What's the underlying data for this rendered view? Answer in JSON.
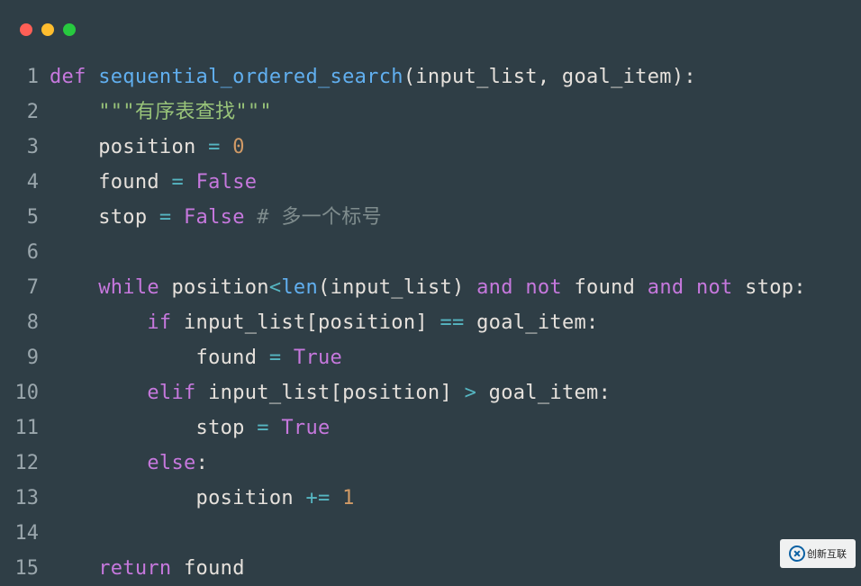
{
  "window": {
    "dots": [
      "red",
      "yellow",
      "green"
    ]
  },
  "code": {
    "function_name": "sequential_ordered_search",
    "params": "(input_list, goal_item)",
    "docstring": "\"\"\"有序表查找\"\"\"",
    "pos_var": "position",
    "eq": " = ",
    "zero": "0",
    "found_var": "found",
    "false": "False",
    "stop_var": "stop",
    "comment": "# 多一个标号",
    "while_kw": "while",
    "lt": "<",
    "len": "len",
    "ilist": "input_list",
    "and_kw": "and",
    "not_kw": "not",
    "if_kw": "if",
    "eqeq": " == ",
    "goal": "goal_item",
    "true": "True",
    "elif_kw": "elif",
    "gt": " > ",
    "else_kw": "else",
    "pluseq": " += ",
    "one": "1",
    "return_kw": "return",
    "def_kw": "def",
    "colon": ":",
    "lbracket": "[",
    "rbracket": "]",
    "lparen": "(",
    "rparen": ")"
  },
  "line_numbers": [
    "1",
    "2",
    "3",
    "4",
    "5",
    "6",
    "7",
    "8",
    "9",
    "10",
    "11",
    "12",
    "13",
    "14",
    "15"
  ],
  "watermark_text": "创新互联"
}
